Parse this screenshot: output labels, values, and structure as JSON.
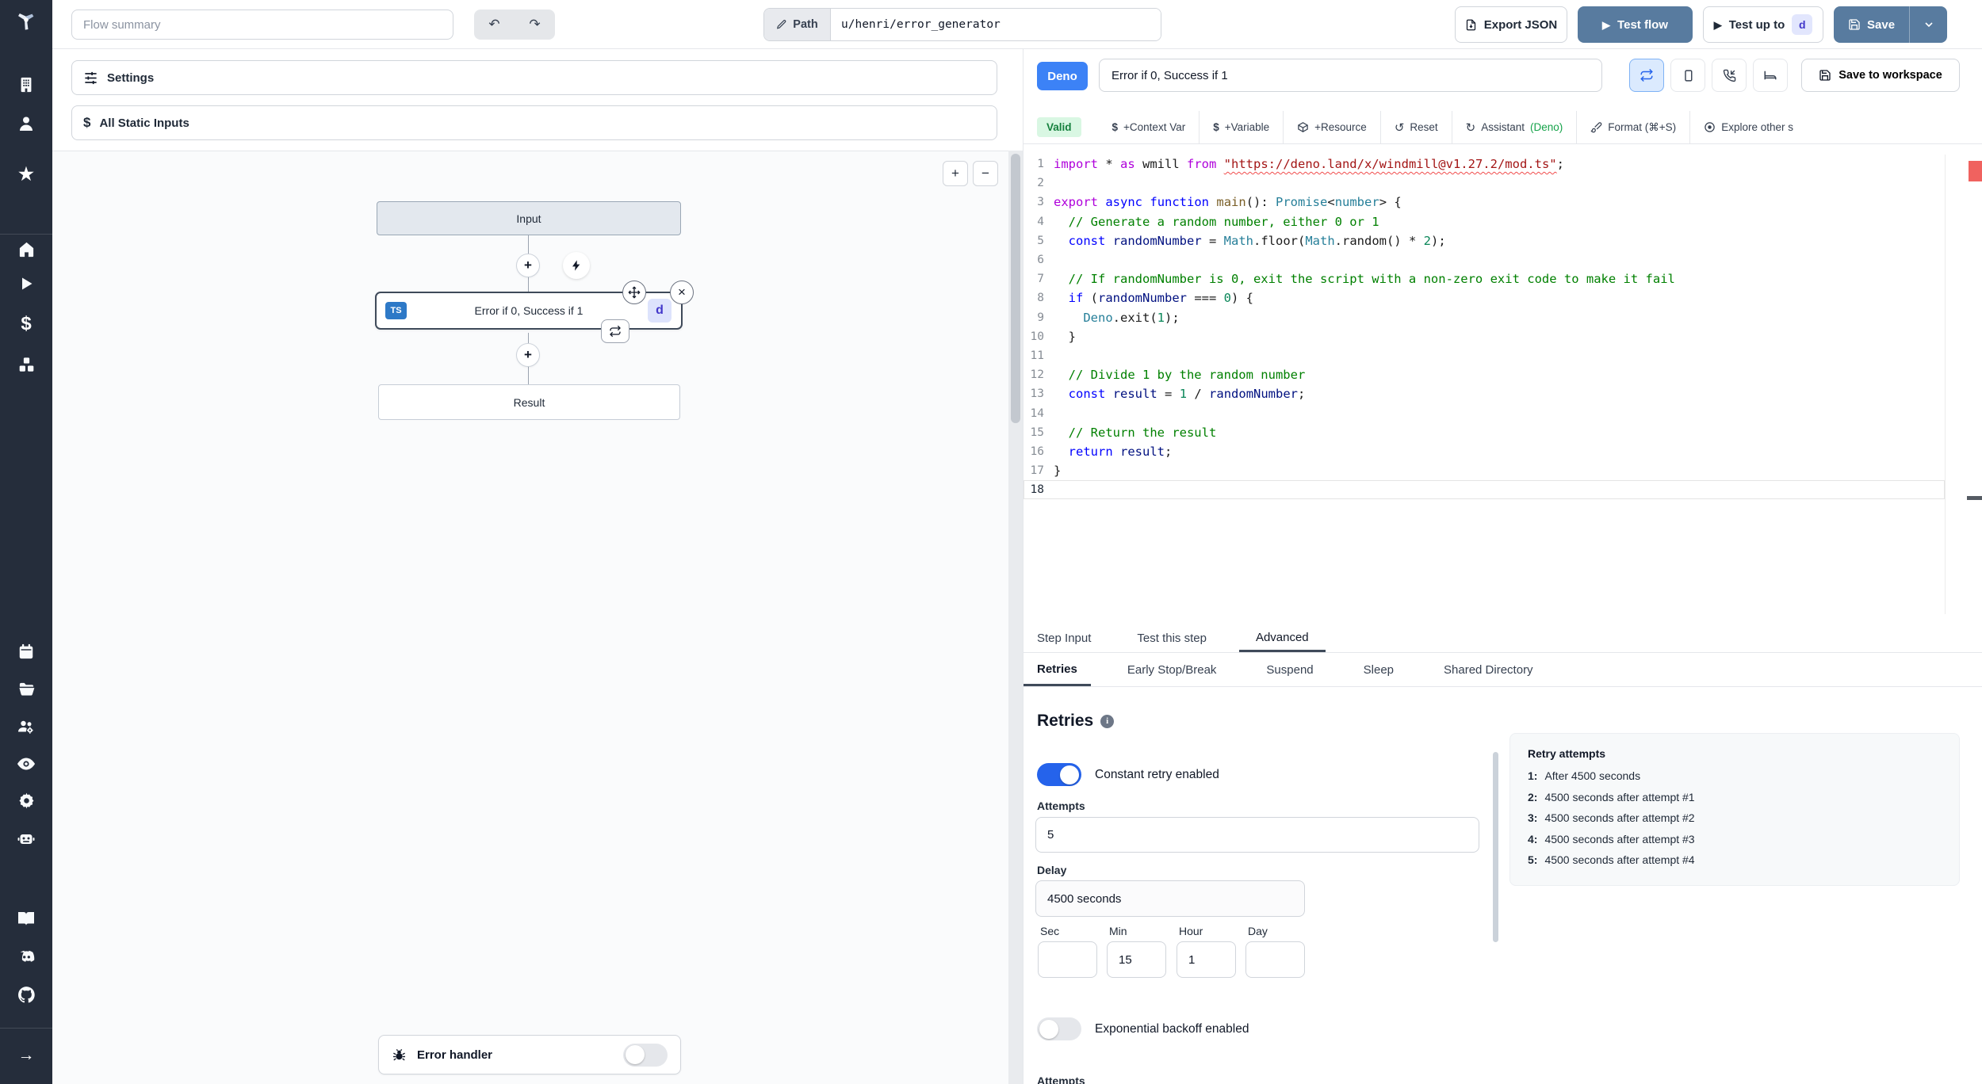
{
  "colors": {
    "primary_blue": "#587b9f",
    "deno_blue": "#3c82f6",
    "valid_green": "#15803d",
    "toggle_on": "#2563eb",
    "error_red": "#f14c4c"
  },
  "topbar": {
    "flow_summary_placeholder": "Flow summary",
    "undo_icon": "↶",
    "redo_icon": "↷",
    "path_label": "Path",
    "path_value": "u/henri/error_generator",
    "export_json": "Export JSON",
    "test_flow": "Test flow",
    "test_up_to": "Test up to",
    "test_up_to_badge": "d",
    "save": "Save",
    "play_icon": "▶"
  },
  "flow": {
    "settings": "Settings",
    "all_static_inputs": "All Static Inputs",
    "zoom_in": "+",
    "zoom_out": "−",
    "input_node": "Input",
    "step_node": {
      "lang_badge": "TS",
      "title": "Error if 0, Success if 1",
      "id_badge": "d",
      "close_icon": "×",
      "plus_icon": "+"
    },
    "result_node": "Result",
    "error_handler": "Error handler",
    "dollar_icon": "$",
    "star_icon": "★",
    "arrow_icon": "→"
  },
  "editor": {
    "lang_badge": "Deno",
    "title_value": "Error if 0, Success if 1",
    "save_to_workspace": "Save to workspace",
    "toolbar": {
      "valid": "Valid",
      "context_var": "+Context Var",
      "variable": "+Variable",
      "resource": "+Resource",
      "reset": "Reset",
      "assistant": "Assistant ",
      "assistant_lang": "(Deno)",
      "format": "Format (⌘+S)",
      "explore": "Explore other s",
      "dollar_icon": "$",
      "reset_icon": "↺",
      "refresh_icon": "↻"
    },
    "code": {
      "lines": [
        {
          "tokens": [
            {
              "c": "kw2",
              "t": "import"
            },
            {
              "c": "pl",
              "t": " * "
            },
            {
              "c": "kw2",
              "t": "as"
            },
            {
              "c": "pl",
              "t": " wmill "
            },
            {
              "c": "kw2",
              "t": "from"
            },
            {
              "c": "pl",
              "t": " "
            },
            {
              "c": "strerr",
              "t": "\"https://deno.land/x/windmill@v1.27.2/mod.ts\""
            },
            {
              "c": "pl",
              "t": ";"
            }
          ]
        },
        {
          "tokens": []
        },
        {
          "tokens": [
            {
              "c": "kw2",
              "t": "export"
            },
            {
              "c": "pl",
              "t": " "
            },
            {
              "c": "kw",
              "t": "async"
            },
            {
              "c": "pl",
              "t": " "
            },
            {
              "c": "kw",
              "t": "function"
            },
            {
              "c": "pl",
              "t": " "
            },
            {
              "c": "fn",
              "t": "main"
            },
            {
              "c": "pl",
              "t": "(): "
            },
            {
              "c": "type",
              "t": "Promise"
            },
            {
              "c": "pl",
              "t": "<"
            },
            {
              "c": "type",
              "t": "number"
            },
            {
              "c": "pl",
              "t": "> {"
            }
          ]
        },
        {
          "tokens": [
            {
              "c": "pl",
              "t": "  "
            },
            {
              "c": "cm",
              "t": "// Generate a random number, either 0 or 1"
            }
          ]
        },
        {
          "tokens": [
            {
              "c": "pl",
              "t": "  "
            },
            {
              "c": "kw",
              "t": "const"
            },
            {
              "c": "pl",
              "t": " "
            },
            {
              "c": "vr",
              "t": "randomNumber"
            },
            {
              "c": "pl",
              "t": " = "
            },
            {
              "c": "type",
              "t": "Math"
            },
            {
              "c": "pl",
              "t": ".floor("
            },
            {
              "c": "type",
              "t": "Math"
            },
            {
              "c": "pl",
              "t": ".random() * "
            },
            {
              "c": "num",
              "t": "2"
            },
            {
              "c": "pl",
              "t": ");"
            }
          ]
        },
        {
          "tokens": []
        },
        {
          "tokens": [
            {
              "c": "pl",
              "t": "  "
            },
            {
              "c": "cm",
              "t": "// If randomNumber is 0, exit the script with a non-zero exit code to make it fail"
            }
          ]
        },
        {
          "tokens": [
            {
              "c": "pl",
              "t": "  "
            },
            {
              "c": "kw",
              "t": "if"
            },
            {
              "c": "pl",
              "t": " ("
            },
            {
              "c": "vr",
              "t": "randomNumber"
            },
            {
              "c": "pl",
              "t": " === "
            },
            {
              "c": "num",
              "t": "0"
            },
            {
              "c": "pl",
              "t": ") {"
            }
          ]
        },
        {
          "tokens": [
            {
              "c": "pl",
              "t": "    "
            },
            {
              "c": "type",
              "t": "Deno"
            },
            {
              "c": "pl",
              "t": ".exit("
            },
            {
              "c": "num",
              "t": "1"
            },
            {
              "c": "pl",
              "t": ");"
            }
          ]
        },
        {
          "tokens": [
            {
              "c": "pl",
              "t": "  }"
            }
          ]
        },
        {
          "tokens": []
        },
        {
          "tokens": [
            {
              "c": "pl",
              "t": "  "
            },
            {
              "c": "cm",
              "t": "// Divide 1 by the random number"
            }
          ]
        },
        {
          "tokens": [
            {
              "c": "pl",
              "t": "  "
            },
            {
              "c": "kw",
              "t": "const"
            },
            {
              "c": "pl",
              "t": " "
            },
            {
              "c": "vr",
              "t": "result"
            },
            {
              "c": "pl",
              "t": " = "
            },
            {
              "c": "num",
              "t": "1"
            },
            {
              "c": "pl",
              "t": " / "
            },
            {
              "c": "vr",
              "t": "randomNumber"
            },
            {
              "c": "pl",
              "t": ";"
            }
          ]
        },
        {
          "tokens": []
        },
        {
          "tokens": [
            {
              "c": "pl",
              "t": "  "
            },
            {
              "c": "cm",
              "t": "// Return the result"
            }
          ]
        },
        {
          "tokens": [
            {
              "c": "pl",
              "t": "  "
            },
            {
              "c": "kw",
              "t": "return"
            },
            {
              "c": "pl",
              "t": " "
            },
            {
              "c": "vr",
              "t": "result"
            },
            {
              "c": "pl",
              "t": ";"
            }
          ]
        },
        {
          "tokens": [
            {
              "c": "pl",
              "t": "}"
            }
          ]
        },
        {
          "tokens": [],
          "current": true
        }
      ]
    }
  },
  "tabs": {
    "main": [
      "Step Input",
      "Test this step",
      "Advanced"
    ],
    "sub": [
      "Retries",
      "Early Stop/Break",
      "Suspend",
      "Sleep",
      "Shared Directory"
    ]
  },
  "retries": {
    "heading": "Retries",
    "info_icon": "i",
    "constant_toggle_label": "Constant retry enabled",
    "attempts_label": "Attempts",
    "attempts_value": "5",
    "delay_label": "Delay",
    "delay_value": "4500 seconds",
    "time_fields": [
      {
        "label": "Sec",
        "value": ""
      },
      {
        "label": "Min",
        "value": "15"
      },
      {
        "label": "Hour",
        "value": "1"
      },
      {
        "label": "Day",
        "value": ""
      }
    ],
    "exponential_toggle_label": "Exponential backoff enabled",
    "cutoff_label": "Attempts",
    "summary": {
      "title": "Retry attempts",
      "items": [
        {
          "n": "1:",
          "text": "After 4500 seconds"
        },
        {
          "n": "2:",
          "text": "4500 seconds after attempt #1"
        },
        {
          "n": "3:",
          "text": "4500 seconds after attempt #2"
        },
        {
          "n": "4:",
          "text": "4500 seconds after attempt #3"
        },
        {
          "n": "5:",
          "text": "4500 seconds after attempt #4"
        }
      ]
    }
  }
}
